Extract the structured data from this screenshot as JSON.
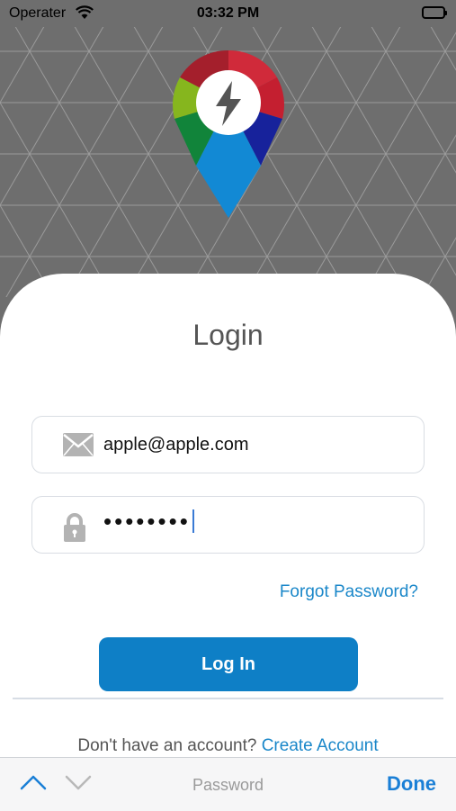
{
  "status_bar": {
    "carrier": "Operater",
    "time": "03:32 PM"
  },
  "app": {
    "logo_icon": "lightning-bolt-location-pin-icon"
  },
  "login": {
    "title": "Login",
    "email_value": "apple@apple.com",
    "email_icon": "envelope-icon",
    "password_value": "••••••••",
    "password_icon": "lock-icon",
    "forgot_password": "Forgot Password?",
    "login_button": "Log In",
    "signup_prompt": "Don't have an account?",
    "create_account": "Create Account"
  },
  "keyboard_toolbar": {
    "field_label": "Password",
    "done": "Done"
  },
  "colors": {
    "accent": "#0e7fc6",
    "link": "#1a87c9",
    "background": "#6e6e6e"
  }
}
